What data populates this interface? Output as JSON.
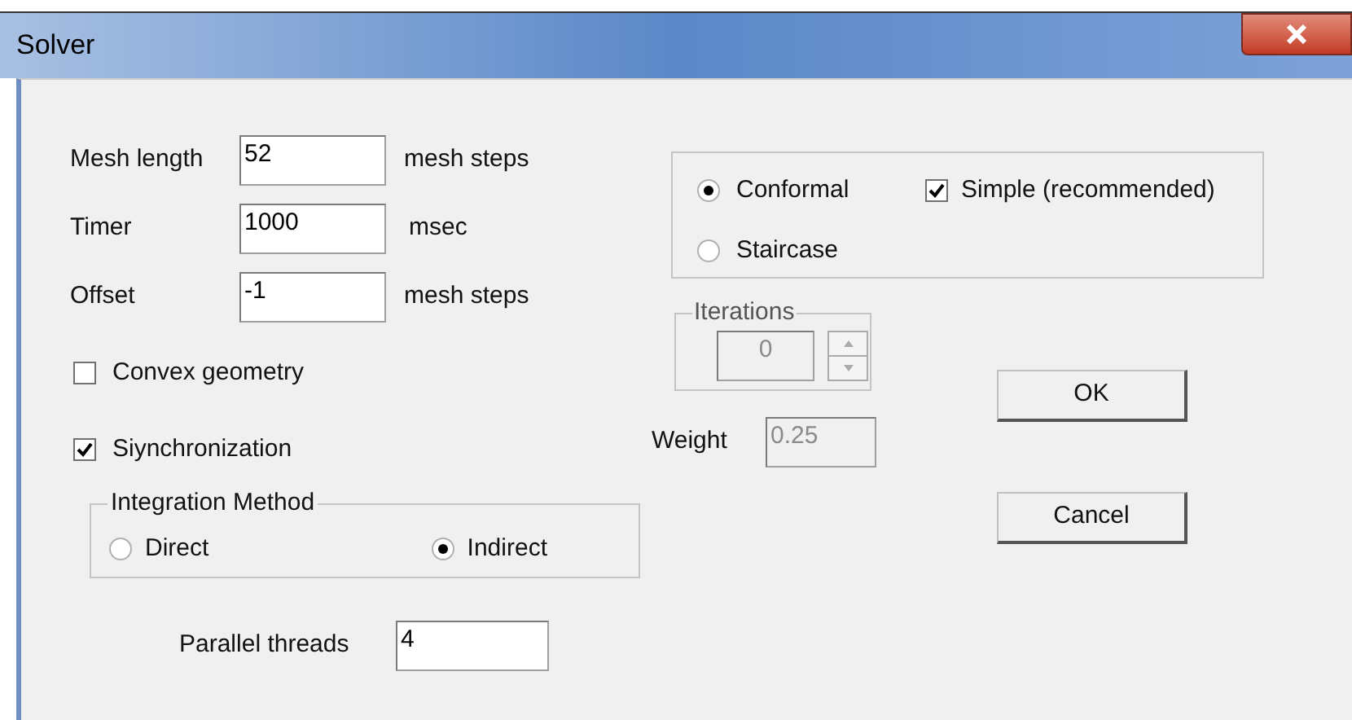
{
  "window": {
    "title": "Solver"
  },
  "fields": [
    {
      "label": "Mesh length",
      "value": "52",
      "unit": "mesh steps"
    },
    {
      "label": "Timer",
      "value": "1000",
      "unit": "msec"
    },
    {
      "label": "Offset",
      "value": "-1",
      "unit": "mesh steps"
    }
  ],
  "checkboxes": [
    {
      "label": "Convex geometry",
      "checked": false
    },
    {
      "label": "Siynchronization",
      "checked": true
    }
  ],
  "integration_method": {
    "title": "Integration Method",
    "options": [
      {
        "label": "Direct",
        "selected": false
      },
      {
        "label": "Indirect",
        "selected": true
      }
    ]
  },
  "parallel_threads": {
    "label": "Parallel threads",
    "value": "4"
  },
  "geometry": {
    "options": [
      {
        "label": "Conformal",
        "selected": true
      },
      {
        "label": "Staircase",
        "selected": false
      }
    ],
    "simple": {
      "label": "Simple (recommended)",
      "checked": true
    }
  },
  "iterations": {
    "title": "Iterations",
    "value": "0",
    "disabled": true
  },
  "weight": {
    "label": "Weight",
    "value": "0.25",
    "disabled": true
  },
  "buttons": [
    "OK",
    "Cancel"
  ]
}
